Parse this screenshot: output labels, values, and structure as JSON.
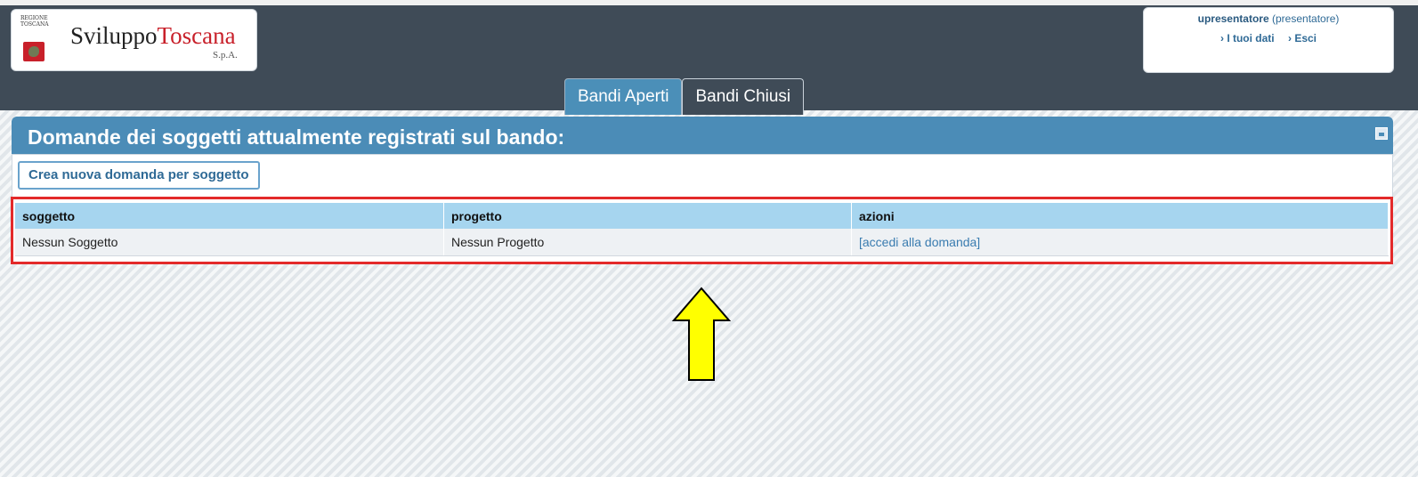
{
  "header": {
    "logo": {
      "region": "REGIONE TOSCANA",
      "name_main": "Sviluppo",
      "name_accent": "Toscana",
      "sub": "S.p.A."
    },
    "user": {
      "username": "upresentatore",
      "role": "(presentatore)",
      "link_my_data": "› I tuoi dati",
      "link_logout": "› Esci"
    }
  },
  "tabs": [
    {
      "label": "Bandi Aperti",
      "active": true
    },
    {
      "label": "Bandi Chiusi",
      "active": false
    }
  ],
  "panel": {
    "title": "Domande dei soggetti attualmente registrati sul bando:",
    "new_button": "Crea nuova domanda per soggetto"
  },
  "table": {
    "headers": [
      "soggetto",
      "progetto",
      "azioni"
    ],
    "rows": [
      [
        "Nessun Soggetto",
        "Nessun Progetto",
        "[accedi alla domanda]"
      ]
    ]
  },
  "colors": {
    "header_bg": "#3f4b57",
    "panel_title_bg": "#4b8cb7",
    "table_header_bg": "#a6d5ef",
    "highlight_border": "#e32a2a",
    "arrow_fill": "#ffff00"
  }
}
